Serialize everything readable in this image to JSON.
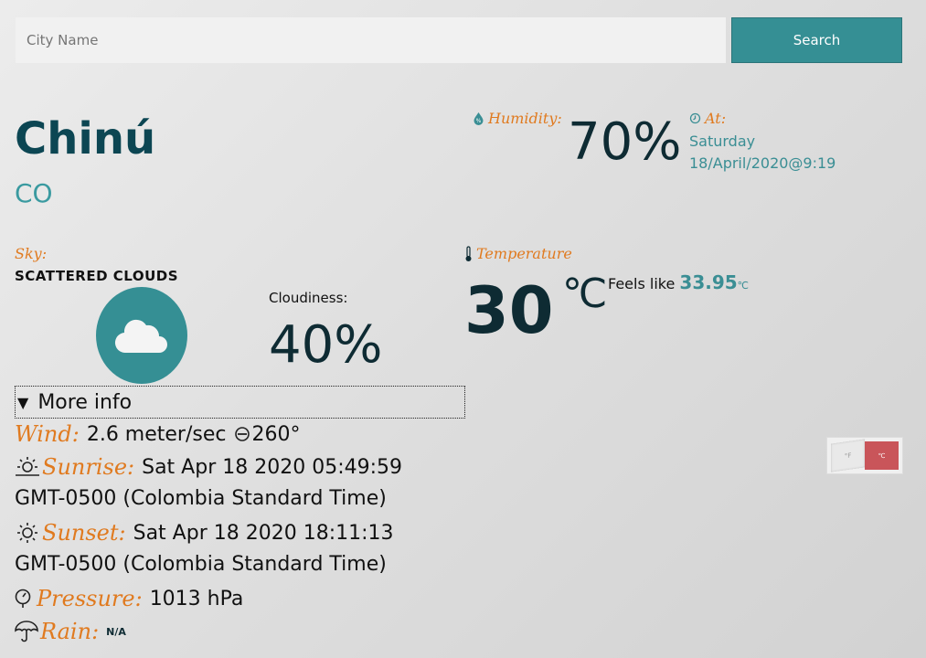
{
  "search": {
    "placeholder": "City Name",
    "button_label": "Search"
  },
  "location": {
    "city": "Chinú",
    "country": "CO"
  },
  "humidity": {
    "label": "Humidity:",
    "value": "70%"
  },
  "at": {
    "label": "At:",
    "day": "Saturday",
    "date": "18/April/2020@9:19"
  },
  "sky": {
    "label": "Sky:",
    "description": "SCATTERED CLOUDS",
    "icon": "cloud-icon"
  },
  "cloudiness": {
    "label": "Cloudiness:",
    "value": "40%"
  },
  "temperature": {
    "label": "Temperature",
    "value": "30",
    "unit": "℃",
    "feels_like_label": "Feels like",
    "feels_like_value": "33.95",
    "feels_like_unit": "℃"
  },
  "unit_toggle": {
    "fahrenheit": "°F",
    "celsius": "℃"
  },
  "more_info": {
    "summary": "More info",
    "wind_label": "Wind:",
    "wind_value": "2.6 meter/sec",
    "wind_direction": "260°",
    "sunrise_label": "Sunrise:",
    "sunrise_value": "Sat Apr 18 2020 05:49:59",
    "sunrise_tz": "GMT-0500 (Colombia Standard Time)",
    "sunset_label": "Sunset:",
    "sunset_value": "Sat Apr 18 2020 18:11:13",
    "sunset_tz": "GMT-0500 (Colombia Standard Time)",
    "pressure_label": "Pressure:",
    "pressure_value": "1013 hPa",
    "rain_label": "Rain:",
    "rain_value": "N/A"
  },
  "colors": {
    "accent": "#358f94",
    "label": "#e07a1f",
    "heading": "#0c4653",
    "toggle_active": "#c9555a"
  }
}
